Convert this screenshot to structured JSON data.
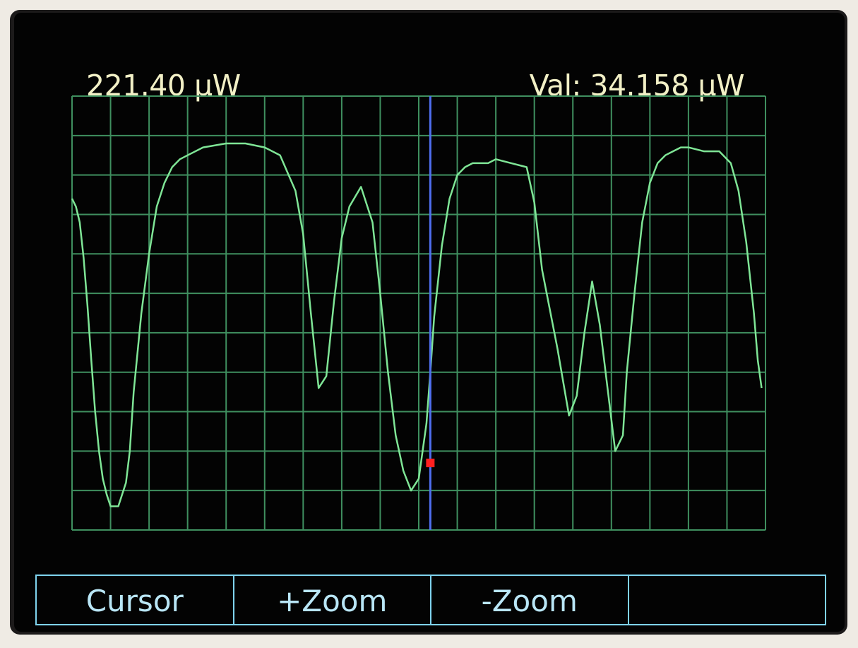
{
  "header": {
    "scale_readout": "221.40 µW",
    "value_readout": "Val: 34.158 µW"
  },
  "softkeys": [
    "Cursor",
    "+Zoom",
    "-Zoom",
    ""
  ],
  "colors": {
    "trace": "#7fe596",
    "grid": "#3f8f5f",
    "cursor": "#4f6ff0",
    "cursor_marker": "#ff2020",
    "header_text": "#f2f0c6",
    "softkey_text": "#b9e6f6",
    "softkey_border": "#7fd3ee",
    "screen_bg": "#030303"
  },
  "chart_data": {
    "type": "line",
    "title": "",
    "xlabel": "",
    "ylabel": "",
    "grid": true,
    "grid_divisions": {
      "x": 18,
      "y": 11
    },
    "x": [
      0,
      0.1,
      0.2,
      0.3,
      0.4,
      0.5,
      0.6,
      0.7,
      0.8,
      0.9,
      1.0,
      1.2,
      1.4,
      1.5,
      1.6,
      1.8,
      2.0,
      2.2,
      2.4,
      2.6,
      2.8,
      3.0,
      3.4,
      4.0,
      4.5,
      5.0,
      5.4,
      5.8,
      6.0,
      6.2,
      6.4,
      6.6,
      6.8,
      7.0,
      7.2,
      7.5,
      7.8,
      8.0,
      8.2,
      8.4,
      8.6,
      8.8,
      9.0,
      9.2,
      9.3,
      9.4,
      9.6,
      9.8,
      10.0,
      10.2,
      10.4,
      10.8,
      11.0,
      11.4,
      11.8,
      12.0,
      12.2,
      12.6,
      12.9,
      13.1,
      13.3,
      13.5,
      13.7,
      13.9,
      14.1,
      14.3,
      14.4,
      14.6,
      14.8,
      15.0,
      15.2,
      15.4,
      15.6,
      15.8,
      16.0,
      16.4,
      16.8,
      17.1,
      17.3,
      17.5,
      17.7,
      17.8,
      17.9
    ],
    "y": [
      8.4,
      8.2,
      7.8,
      6.9,
      5.7,
      4.3,
      3.0,
      2.0,
      1.3,
      0.9,
      0.6,
      0.6,
      1.2,
      2.0,
      3.5,
      5.5,
      7.0,
      8.2,
      8.8,
      9.2,
      9.4,
      9.5,
      9.7,
      9.8,
      9.8,
      9.7,
      9.5,
      8.6,
      7.5,
      5.5,
      3.6,
      3.9,
      5.8,
      7.4,
      8.2,
      8.7,
      7.8,
      6.0,
      4.0,
      2.4,
      1.5,
      1.0,
      1.3,
      2.7,
      4.0,
      5.4,
      7.2,
      8.4,
      9.0,
      9.2,
      9.3,
      9.3,
      9.4,
      9.3,
      9.2,
      8.3,
      6.6,
      4.6,
      2.9,
      3.4,
      5.0,
      6.3,
      5.2,
      3.6,
      2.0,
      2.4,
      4.0,
      6.0,
      7.8,
      8.8,
      9.3,
      9.5,
      9.6,
      9.7,
      9.7,
      9.6,
      9.6,
      9.3,
      8.6,
      7.3,
      5.5,
      4.3,
      3.6
    ],
    "xlim": [
      0,
      18
    ],
    "ylim": [
      0,
      11
    ],
    "cursor": {
      "x": 9.3,
      "y": 1.7
    }
  }
}
